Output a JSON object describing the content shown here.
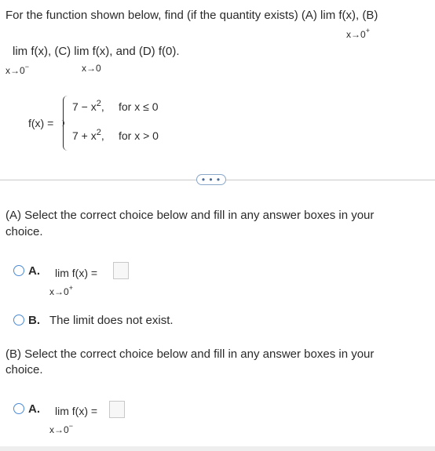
{
  "question": {
    "line1": "For the function shown below, find (if the quantity exists) (A)  lim  f(x), (B)",
    "line1_sub": "x→0",
    "line1_sup": "+",
    "line2": "lim  f(x), (C) lim  f(x), and (D) f(0).",
    "line2_sub1": "x→0",
    "line2_sup1": "−",
    "line2_sub2": "x→0"
  },
  "function": {
    "name": "f(x) =",
    "piece1_expr": "7 − x",
    "piece1_exp": "2",
    "piece1_comma": ",",
    "piece1_cond": "for x ≤ 0",
    "piece2_expr": "7 + x",
    "piece2_exp": "2",
    "piece2_comma": ",",
    "piece2_cond": "for x > 0"
  },
  "more_button": "• • •",
  "partA": {
    "prompt_line1": "(A) Select the correct choice below and fill in any answer boxes in your",
    "prompt_line2": "choice.",
    "optionA_letter": "A.",
    "optionA_text": "lim  f(x) =",
    "optionA_sub": "x→0",
    "optionA_sup": "+",
    "optionB_letter": "B.",
    "optionB_text": "The limit does not exist."
  },
  "partB": {
    "prompt_line1": "(B) Select the correct choice below and fill in any answer boxes in your",
    "prompt_line2": "choice.",
    "optionA_letter": "A.",
    "optionA_text": "lim  f(x) =",
    "optionA_sub": "x→0",
    "optionA_sup": "−"
  }
}
